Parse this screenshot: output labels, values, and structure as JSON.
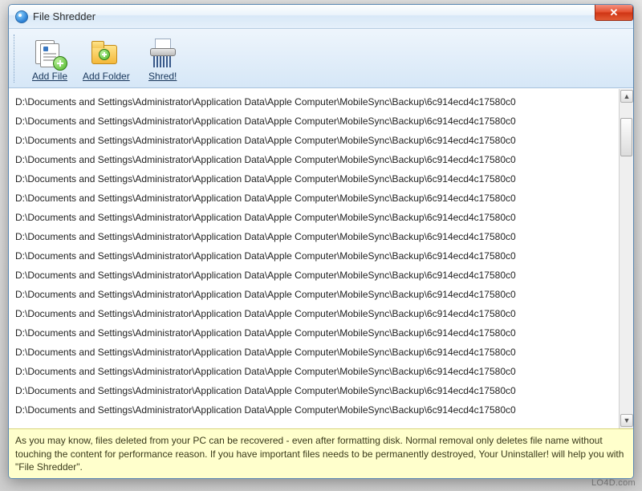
{
  "window": {
    "title": "File Shredder"
  },
  "toolbar": {
    "add_file_label": "Add File",
    "add_folder_label": "Add Folder",
    "shred_label": "Shred!"
  },
  "file_list": {
    "items": [
      "D:\\Documents and Settings\\Administrator\\Application Data\\Apple Computer\\MobileSync\\Backup\\6c914ecd4c17580c0",
      "D:\\Documents and Settings\\Administrator\\Application Data\\Apple Computer\\MobileSync\\Backup\\6c914ecd4c17580c0",
      "D:\\Documents and Settings\\Administrator\\Application Data\\Apple Computer\\MobileSync\\Backup\\6c914ecd4c17580c0",
      "D:\\Documents and Settings\\Administrator\\Application Data\\Apple Computer\\MobileSync\\Backup\\6c914ecd4c17580c0",
      "D:\\Documents and Settings\\Administrator\\Application Data\\Apple Computer\\MobileSync\\Backup\\6c914ecd4c17580c0",
      "D:\\Documents and Settings\\Administrator\\Application Data\\Apple Computer\\MobileSync\\Backup\\6c914ecd4c17580c0",
      "D:\\Documents and Settings\\Administrator\\Application Data\\Apple Computer\\MobileSync\\Backup\\6c914ecd4c17580c0",
      "D:\\Documents and Settings\\Administrator\\Application Data\\Apple Computer\\MobileSync\\Backup\\6c914ecd4c17580c0",
      "D:\\Documents and Settings\\Administrator\\Application Data\\Apple Computer\\MobileSync\\Backup\\6c914ecd4c17580c0",
      "D:\\Documents and Settings\\Administrator\\Application Data\\Apple Computer\\MobileSync\\Backup\\6c914ecd4c17580c0",
      "D:\\Documents and Settings\\Administrator\\Application Data\\Apple Computer\\MobileSync\\Backup\\6c914ecd4c17580c0",
      "D:\\Documents and Settings\\Administrator\\Application Data\\Apple Computer\\MobileSync\\Backup\\6c914ecd4c17580c0",
      "D:\\Documents and Settings\\Administrator\\Application Data\\Apple Computer\\MobileSync\\Backup\\6c914ecd4c17580c0",
      "D:\\Documents and Settings\\Administrator\\Application Data\\Apple Computer\\MobileSync\\Backup\\6c914ecd4c17580c0",
      "D:\\Documents and Settings\\Administrator\\Application Data\\Apple Computer\\MobileSync\\Backup\\6c914ecd4c17580c0",
      "D:\\Documents and Settings\\Administrator\\Application Data\\Apple Computer\\MobileSync\\Backup\\6c914ecd4c17580c0",
      "D:\\Documents and Settings\\Administrator\\Application Data\\Apple Computer\\MobileSync\\Backup\\6c914ecd4c17580c0"
    ]
  },
  "info_bar": {
    "text": "As you may know, files deleted from your PC can be recovered - even after formatting disk. Normal removal only deletes file name without touching the content for performance reason. If you have important files needs to be permanently destroyed, Your Uninstaller! will help you with \"File Shredder\"."
  },
  "watermark": "LO4D.com"
}
